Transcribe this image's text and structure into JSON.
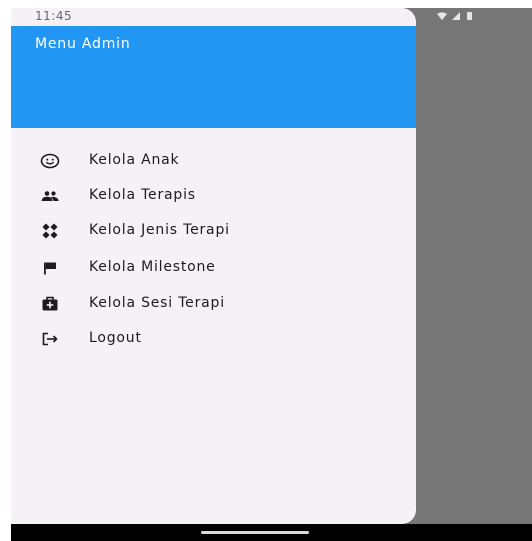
{
  "status_bar": {
    "time": "11:45",
    "icons": [
      "wifi-icon",
      "cellular-signal-icon",
      "battery-icon"
    ]
  },
  "drawer": {
    "title": "Menu Admin",
    "items": [
      {
        "label": "Kelola Anak",
        "icon": "child-face-icon"
      },
      {
        "label": "Kelola Terapis",
        "icon": "people-icon"
      },
      {
        "label": "Kelola Jenis Terapi",
        "icon": "category-icon"
      },
      {
        "label": "Kelola Milestone",
        "icon": "flag-icon"
      },
      {
        "label": "Kelola Sesi Terapi",
        "icon": "medical-kit-icon"
      },
      {
        "label": "Logout",
        "icon": "logout-icon"
      }
    ]
  },
  "colors": {
    "header": "#2196f3",
    "drawer_background": "#f5f1f7",
    "scrim": "#767676",
    "text": "#1d1b20"
  }
}
